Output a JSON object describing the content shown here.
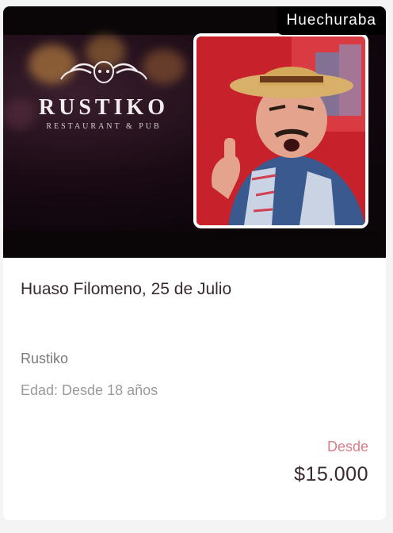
{
  "event": {
    "location_tag": "Huechuraba",
    "title": "Huaso Filomeno, 25 de Julio",
    "venue": "Rustiko",
    "age": "Edad: Desde 18 años",
    "price_prefix": "Desde",
    "price": "$15.000"
  },
  "poster": {
    "logo_name": "RUSTIKO",
    "logo_subtitle": "RESTAURANT & PUB"
  },
  "colors": {
    "price_prefix": "#d77c88",
    "text_dark": "#3a2a2f",
    "tag_bg": "#000000"
  }
}
